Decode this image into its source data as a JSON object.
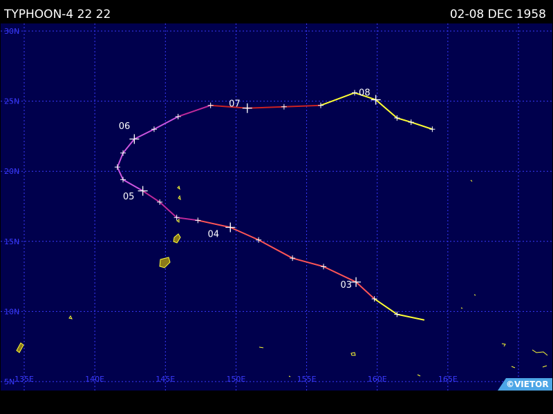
{
  "header": {
    "storm_label": "TYPHOON-4 22 22",
    "date_range": "02-08 DEC 1958"
  },
  "credit": "©VIETOR",
  "colors": {
    "ocean": "#00004d",
    "grid": "#3a3aff",
    "land": "#8c7a1a",
    "coast": "#ffff33",
    "track_tropical_depression": "#ffff33",
    "track_tropical_storm": "#ff5555",
    "track_typhoon_cat1": "#cc2222",
    "track_typhoon_cat2": "#c02a9a",
    "track_typhoon_cat4": "#cc55e0",
    "track_remnant": "#777777"
  },
  "map": {
    "lon_range": [
      135,
      170
    ],
    "lat_range": [
      5,
      30
    ],
    "lon_labels": [
      "135E",
      "140E",
      "145E",
      "150E",
      "155E",
      "160E",
      "165E"
    ],
    "lat_labels": [
      "5N",
      "10N",
      "15N",
      "20N",
      "25N",
      "30N"
    ],
    "grid": "dotted"
  },
  "track": {
    "points": [
      {
        "lon": 163.3,
        "lat": 9.4,
        "intensity": "remnant"
      },
      {
        "lon": 161.4,
        "lat": 9.8,
        "intensity": "td"
      },
      {
        "lon": 159.8,
        "lat": 10.9,
        "intensity": "td"
      },
      {
        "lon": 158.5,
        "lat": 12.1,
        "intensity": "ts"
      },
      {
        "lon": 156.2,
        "lat": 13.2,
        "intensity": "ts"
      },
      {
        "lon": 154.0,
        "lat": 13.8,
        "intensity": "ts"
      },
      {
        "lon": 151.6,
        "lat": 15.1,
        "intensity": "ts"
      },
      {
        "lon": 149.6,
        "lat": 16.0,
        "intensity": "ts"
      },
      {
        "lon": 147.3,
        "lat": 16.5,
        "intensity": "ts"
      },
      {
        "lon": 145.8,
        "lat": 16.7,
        "intensity": "cat2"
      },
      {
        "lon": 144.6,
        "lat": 17.8,
        "intensity": "cat2"
      },
      {
        "lon": 143.4,
        "lat": 18.6,
        "intensity": "cat2"
      },
      {
        "lon": 142.0,
        "lat": 19.4,
        "intensity": "cat4"
      },
      {
        "lon": 141.6,
        "lat": 20.3,
        "intensity": "cat4"
      },
      {
        "lon": 142.0,
        "lat": 21.3,
        "intensity": "cat4"
      },
      {
        "lon": 142.8,
        "lat": 22.3,
        "intensity": "cat4"
      },
      {
        "lon": 144.2,
        "lat": 23.0,
        "intensity": "cat4"
      },
      {
        "lon": 145.9,
        "lat": 23.9,
        "intensity": "cat4"
      },
      {
        "lon": 148.2,
        "lat": 24.7,
        "intensity": "cat2"
      },
      {
        "lon": 150.8,
        "lat": 24.5,
        "intensity": "cat1"
      },
      {
        "lon": 153.4,
        "lat": 24.6,
        "intensity": "cat1"
      },
      {
        "lon": 156.0,
        "lat": 24.7,
        "intensity": "cat1"
      },
      {
        "lon": 158.4,
        "lat": 25.6,
        "intensity": "td"
      },
      {
        "lon": 159.9,
        "lat": 25.1,
        "intensity": "td"
      },
      {
        "lon": 161.4,
        "lat": 23.8,
        "intensity": "td"
      },
      {
        "lon": 162.4,
        "lat": 23.5,
        "intensity": "td"
      },
      {
        "lon": 163.9,
        "lat": 23.0,
        "intensity": "td"
      }
    ],
    "day_labels": [
      {
        "text": "03",
        "lon": 157.8,
        "lat": 11.7
      },
      {
        "text": "04",
        "lon": 148.4,
        "lat": 15.3
      },
      {
        "text": "05",
        "lon": 142.4,
        "lat": 18.0
      },
      {
        "text": "06",
        "lon": 142.1,
        "lat": 23.0
      },
      {
        "text": "07",
        "lon": 149.9,
        "lat": 24.6
      },
      {
        "text": "08",
        "lon": 159.1,
        "lat": 25.4
      }
    ],
    "day_markers": [
      {
        "lon": 158.5,
        "lat": 12.1
      },
      {
        "lon": 149.6,
        "lat": 16.0
      },
      {
        "lon": 143.4,
        "lat": 18.6
      },
      {
        "lon": 142.8,
        "lat": 22.3
      },
      {
        "lon": 150.8,
        "lat": 24.5
      },
      {
        "lon": 159.9,
        "lat": 25.1
      }
    ]
  }
}
